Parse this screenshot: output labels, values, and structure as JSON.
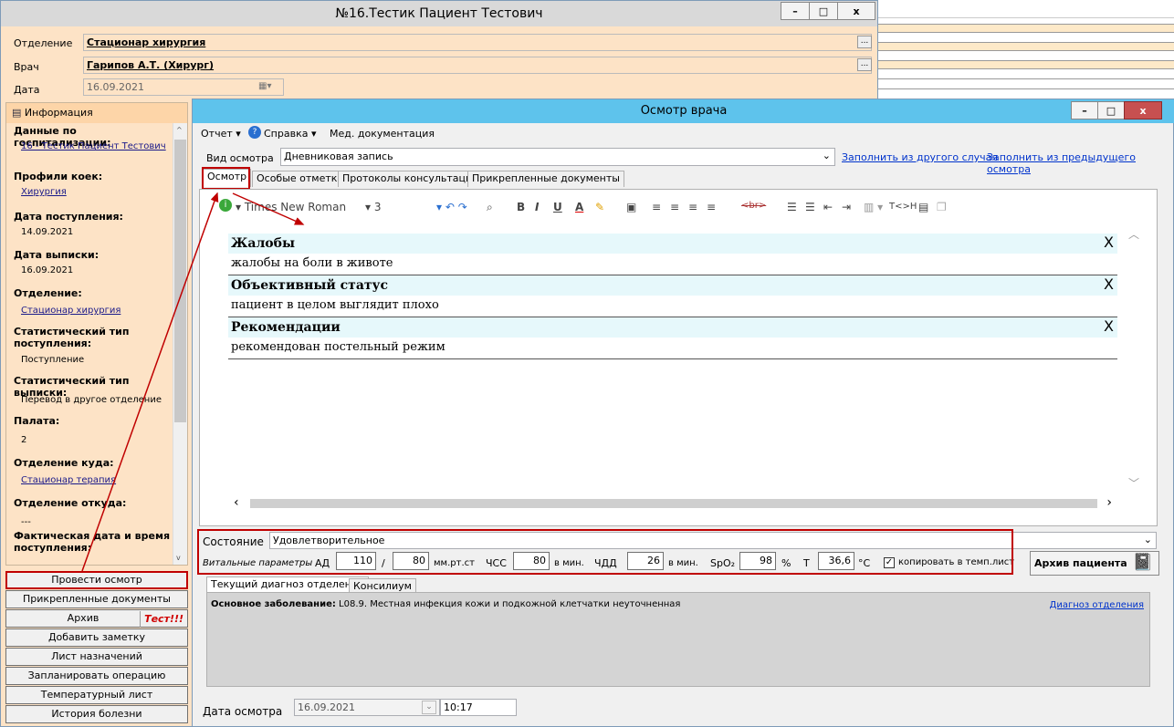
{
  "main_window": {
    "title": "№16.Тестик Пациент Тестович",
    "dept_label": "Отделение",
    "dept_value": "Стационар хирургия",
    "doctor_label": "Врач",
    "doctor_value": "Гарипов А.Т. (Хирург)",
    "date_label": "Дата",
    "date_value": "16.09.2021"
  },
  "window_buttons": {
    "minimize": "–",
    "maximize": "□",
    "close": "x"
  },
  "left_panel": {
    "header": "Информация",
    "sections": [
      {
        "h": "Данные по госпитализации:",
        "v": "16 - Тестик Пациент Тестович",
        "link": true
      },
      {
        "h": "Профили коек:",
        "v": "Хирургия",
        "link": true
      },
      {
        "h": "Дата поступления:",
        "v": "14.09.2021",
        "link": false
      },
      {
        "h": "Дата выписки:",
        "v": "16.09.2021",
        "link": false
      },
      {
        "h": "Отделение:",
        "v": "Стационар хирургия",
        "link": true
      },
      {
        "h": "Статистический тип поступления:",
        "v": "Поступление",
        "link": false
      },
      {
        "h": "Статистический тип выписки:",
        "v": "Перевод в другое отделение",
        "link": false
      },
      {
        "h": "Палата:",
        "v": "2",
        "link": false
      },
      {
        "h": "Отделение куда:",
        "v": "Стационар терапия",
        "link": true
      },
      {
        "h": "Отделение откуда:",
        "v": "---",
        "link": false
      },
      {
        "h": "Фактическая дата и время поступления:",
        "v": "",
        "link": false
      }
    ]
  },
  "actions": {
    "exam": "Провести осмотр",
    "attached": "Прикрепленные документы",
    "archive": "Архив",
    "test_badge": "Тест!!!",
    "note": "Добавить заметку",
    "prescriptions": "Лист назначений",
    "surgery": "Запланировать операцию",
    "temperature": "Температурный лист",
    "history": "История болезни"
  },
  "exam_window": {
    "title": "Осмотр врача",
    "menu": {
      "report": "Отчет ▾",
      "help": "Справка ▾",
      "med_docs": "Мед. документация"
    },
    "type_label": "Вид осмотра",
    "type_value": "Дневниковая запись",
    "fill_other": "Заполнить из другого случая",
    "fill_prev": "Заполнить из предыдущего осмотра",
    "tabs": [
      "Осмотр",
      "Особые отметки",
      "Протоколы консультаций",
      "Прикрепленные документы"
    ]
  },
  "toolbar": {
    "font": "Times New Roman",
    "size": "3",
    "br": "<br>",
    "tag": "T<>H"
  },
  "editor_sections": [
    {
      "title": "Жалобы",
      "text": "жалобы на боли в животе"
    },
    {
      "title": "Объективный статус",
      "text": "пациент в целом выглядит плохо"
    },
    {
      "title": "Рекомендации",
      "text": "рекомендован постельный режим"
    }
  ],
  "editor_close": "X",
  "condition": {
    "label": "Состояние",
    "value": "Удовлетворительное"
  },
  "vitals": {
    "label": "Витальные параметры",
    "ad_label": "АД",
    "sys": "110",
    "sep": "/",
    "dia": "80",
    "ad_unit": "мм.рт.ст",
    "hr_label": "ЧСС",
    "hr": "80",
    "hr_unit": "в мин.",
    "rr_label": "ЧДД",
    "rr": "26",
    "rr_unit": "в мин.",
    "spo2_label": "SpO₂",
    "spo2": "98",
    "spo2_unit": "%",
    "t_label": "T",
    "t": "36,6",
    "t_unit": "°C",
    "copy_label": "копировать в темп.лист",
    "copy_checked": true
  },
  "archive_btn": "Архив пациента",
  "diag_tabs": [
    "Текущий диагноз отделения",
    "Консилиум"
  ],
  "diagnosis": {
    "label": "Основное заболевание:",
    "text": " L08.9. Местная инфекция кожи и подкожной клетчатки неуточненная",
    "link": "Диагноз отделения"
  },
  "exam_date": {
    "label": "Дата осмотра",
    "date": "16.09.2021",
    "time": "10:17"
  },
  "colors": {
    "title_bar": "#5ec3ec",
    "left_panel": "#fde3c6",
    "highlight": "#c00000"
  }
}
